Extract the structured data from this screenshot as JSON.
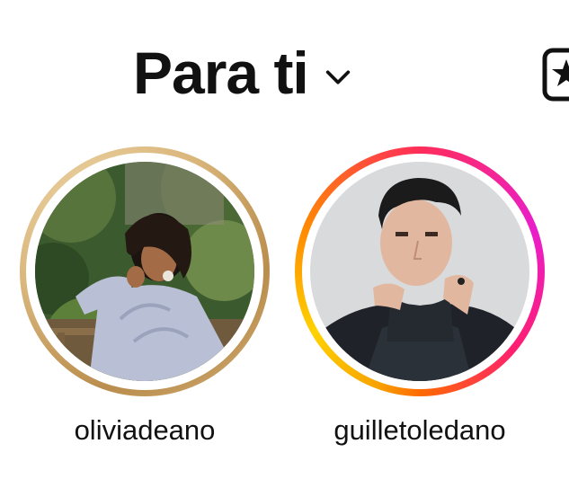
{
  "header": {
    "title": "Para ti",
    "dropdown_icon": "chevron-down-icon",
    "favorites_icon": "favorites-icon"
  },
  "stories": [
    {
      "username": "oliviadeano",
      "ring_style": "close-friends-gold",
      "ring_color": "#d9b57a"
    },
    {
      "username": "guilletoledano",
      "ring_style": "unseen-story-gradient",
      "ring_colors": [
        "#ffd200",
        "#ff8a00",
        "#ff2d5a",
        "#e91ecb"
      ]
    }
  ]
}
